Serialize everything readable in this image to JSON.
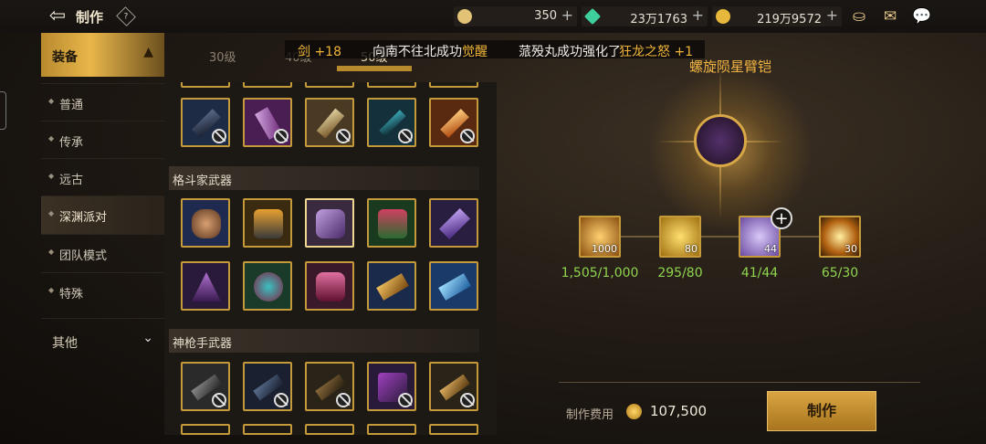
{
  "header": {
    "title": "制作",
    "help_label": "?"
  },
  "currencies": [
    {
      "name": "gold-coin-currency",
      "value": "350",
      "color": "#e2c275"
    },
    {
      "name": "gem-currency",
      "value": "23万1763",
      "color": "#3fcf9c"
    },
    {
      "name": "coin-currency",
      "value": "219万9572",
      "color": "#e8b83c"
    }
  ],
  "sidebar": {
    "main": {
      "label": "装备"
    },
    "items": [
      {
        "label": "普通"
      },
      {
        "label": "传承"
      },
      {
        "label": "远古"
      },
      {
        "label": "深渊派对"
      },
      {
        "label": "团队模式"
      },
      {
        "label": "特殊"
      }
    ],
    "other": {
      "label": "其他"
    }
  },
  "level_tabs": [
    "30级",
    "40级",
    "50级"
  ],
  "announcement": {
    "part1": "剑 +18",
    "part2": "向南不往北成功",
    "part3": "觉醒",
    "part4": "蒎殁丸成功强化了",
    "part5": "狂龙之怒 +1"
  },
  "sections": [
    {
      "label": "格斗家武器"
    },
    {
      "label": "神枪手武器"
    }
  ],
  "detail": {
    "item_name": "螺旋陨星臂铠",
    "materials": [
      {
        "count": "1000",
        "progress": "1,505/1,000"
      },
      {
        "count": "80",
        "progress": "295/80"
      },
      {
        "count": "44",
        "progress": "41/44"
      },
      {
        "count": "30",
        "progress": "65/30"
      }
    ],
    "cost_label": "制作费用",
    "cost_value": "107,500",
    "craft_label": "制作"
  }
}
